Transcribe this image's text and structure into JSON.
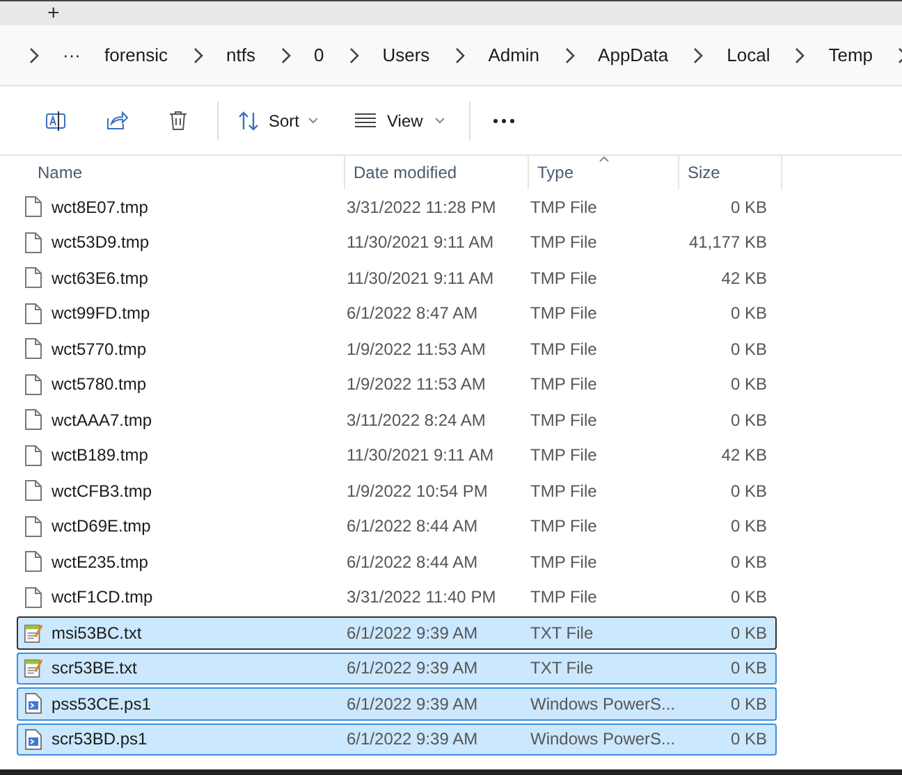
{
  "new_tab_button": "+",
  "breadcrumb": {
    "overflow": "···",
    "segments": [
      "forensic",
      "ntfs",
      "0",
      "Users",
      "Admin",
      "AppData",
      "Local",
      "Temp"
    ]
  },
  "toolbar": {
    "sort": "Sort",
    "view": "View"
  },
  "columns": [
    {
      "label": "Name",
      "sorted": false
    },
    {
      "label": "Date modified",
      "sorted": false
    },
    {
      "label": "Type",
      "sorted": true
    },
    {
      "label": "Size",
      "sorted": false
    }
  ],
  "rows": [
    {
      "kind": "tmp",
      "name": "wct8E07.tmp",
      "date": "3/31/2022 11:28 PM",
      "type": "TMP File",
      "size": "0 KB",
      "selected": false,
      "focused": false
    },
    {
      "kind": "tmp",
      "name": "wct53D9.tmp",
      "date": "11/30/2021 9:11 AM",
      "type": "TMP File",
      "size": "41,177 KB",
      "selected": false,
      "focused": false
    },
    {
      "kind": "tmp",
      "name": "wct63E6.tmp",
      "date": "11/30/2021 9:11 AM",
      "type": "TMP File",
      "size": "42 KB",
      "selected": false,
      "focused": false
    },
    {
      "kind": "tmp",
      "name": "wct99FD.tmp",
      "date": "6/1/2022 8:47 AM",
      "type": "TMP File",
      "size": "0 KB",
      "selected": false,
      "focused": false
    },
    {
      "kind": "tmp",
      "name": "wct5770.tmp",
      "date": "1/9/2022 11:53 AM",
      "type": "TMP File",
      "size": "0 KB",
      "selected": false,
      "focused": false
    },
    {
      "kind": "tmp",
      "name": "wct5780.tmp",
      "date": "1/9/2022 11:53 AM",
      "type": "TMP File",
      "size": "0 KB",
      "selected": false,
      "focused": false
    },
    {
      "kind": "tmp",
      "name": "wctAAA7.tmp",
      "date": "3/11/2022 8:24 AM",
      "type": "TMP File",
      "size": "0 KB",
      "selected": false,
      "focused": false
    },
    {
      "kind": "tmp",
      "name": "wctB189.tmp",
      "date": "11/30/2021 9:11 AM",
      "type": "TMP File",
      "size": "42 KB",
      "selected": false,
      "focused": false
    },
    {
      "kind": "tmp",
      "name": "wctCFB3.tmp",
      "date": "1/9/2022 10:54 PM",
      "type": "TMP File",
      "size": "0 KB",
      "selected": false,
      "focused": false
    },
    {
      "kind": "tmp",
      "name": "wctD69E.tmp",
      "date": "6/1/2022 8:44 AM",
      "type": "TMP File",
      "size": "0 KB",
      "selected": false,
      "focused": false
    },
    {
      "kind": "tmp",
      "name": "wctE235.tmp",
      "date": "6/1/2022 8:44 AM",
      "type": "TMP File",
      "size": "0 KB",
      "selected": false,
      "focused": false
    },
    {
      "kind": "tmp",
      "name": "wctF1CD.tmp",
      "date": "3/31/2022 11:40 PM",
      "type": "TMP File",
      "size": "0 KB",
      "selected": false,
      "focused": false
    },
    {
      "kind": "txt",
      "name": "msi53BC.txt",
      "date": "6/1/2022 9:39 AM",
      "type": "TXT File",
      "size": "0 KB",
      "selected": true,
      "focused": true
    },
    {
      "kind": "txt",
      "name": "scr53BE.txt",
      "date": "6/1/2022 9:39 AM",
      "type": "TXT File",
      "size": "0 KB",
      "selected": true,
      "focused": false
    },
    {
      "kind": "ps1",
      "name": "pss53CE.ps1",
      "date": "6/1/2022 9:39 AM",
      "type": "Windows PowerS...",
      "size": "0 KB",
      "selected": true,
      "focused": false
    },
    {
      "kind": "ps1",
      "name": "scr53BD.ps1",
      "date": "6/1/2022 9:39 AM",
      "type": "Windows PowerS...",
      "size": "0 KB",
      "selected": true,
      "focused": false
    }
  ]
}
